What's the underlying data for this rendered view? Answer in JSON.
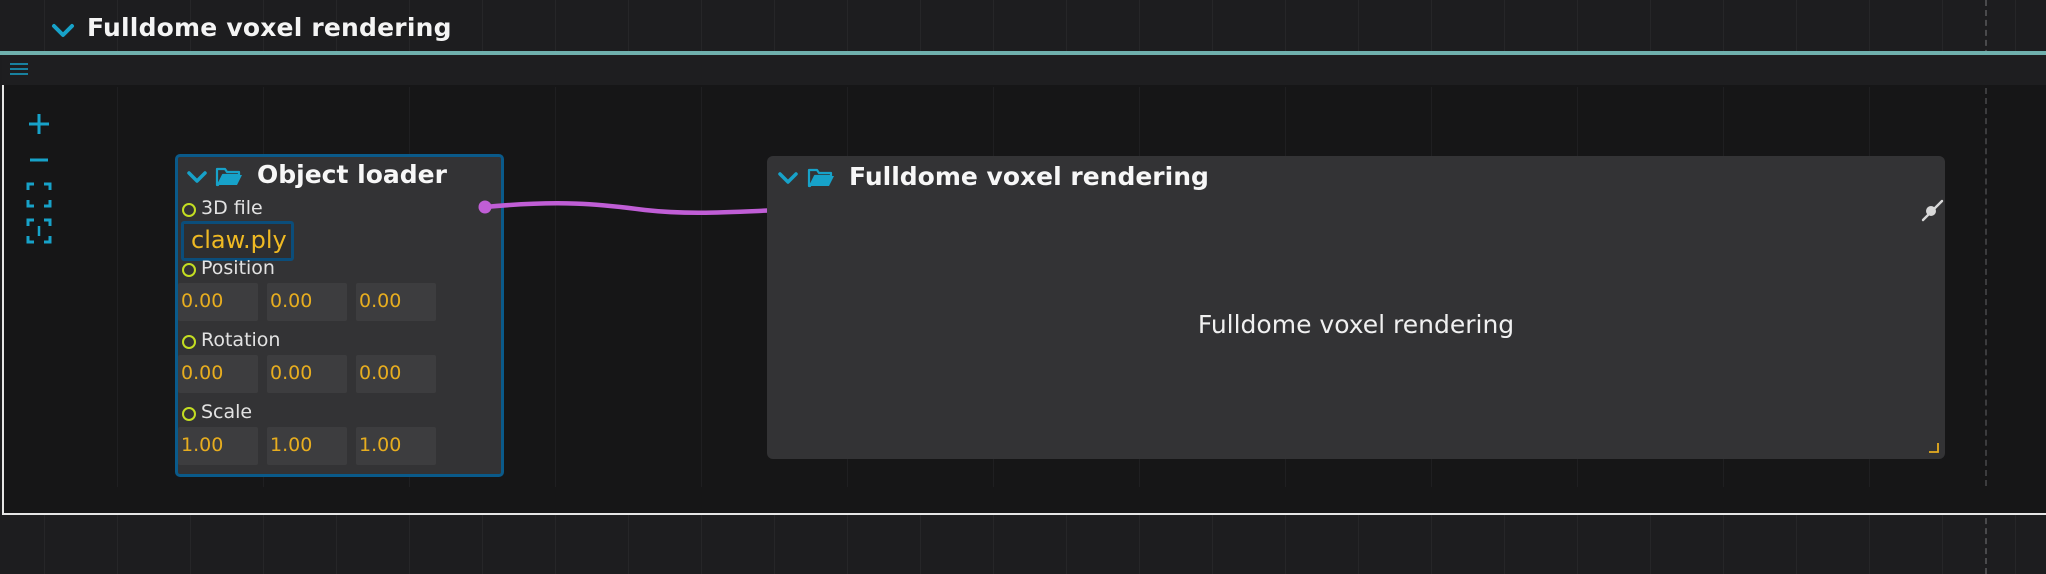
{
  "section": {
    "title": "Fulldome voxel rendering"
  },
  "toolbar": {
    "menu_icon": "hamburger-menu-icon",
    "tools": [
      "zoom-in-icon",
      "zoom-out-icon",
      "fit-view-icon",
      "fit-selection-icon"
    ]
  },
  "colors": {
    "accent": "#17a2c9",
    "teal_bar": "#6fb0ad",
    "wire": "#c05ed6",
    "value": "#e7ad1f",
    "port": "#c3dd22",
    "node_border": "#0a5a8a"
  },
  "object_loader": {
    "title": "Object loader",
    "file_label": "3D file",
    "file_value": "claw.ply",
    "position_label": "Position",
    "position": [
      "0.00",
      "0.00",
      "0.00"
    ],
    "rotation_label": "Rotation",
    "rotation": [
      "0.00",
      "0.00",
      "0.00"
    ],
    "scale_label": "Scale",
    "scale": [
      "1.00",
      "1.00",
      "1.00"
    ]
  },
  "renderer": {
    "title": "Fulldome voxel rendering",
    "body": "Fulldome voxel rendering"
  }
}
